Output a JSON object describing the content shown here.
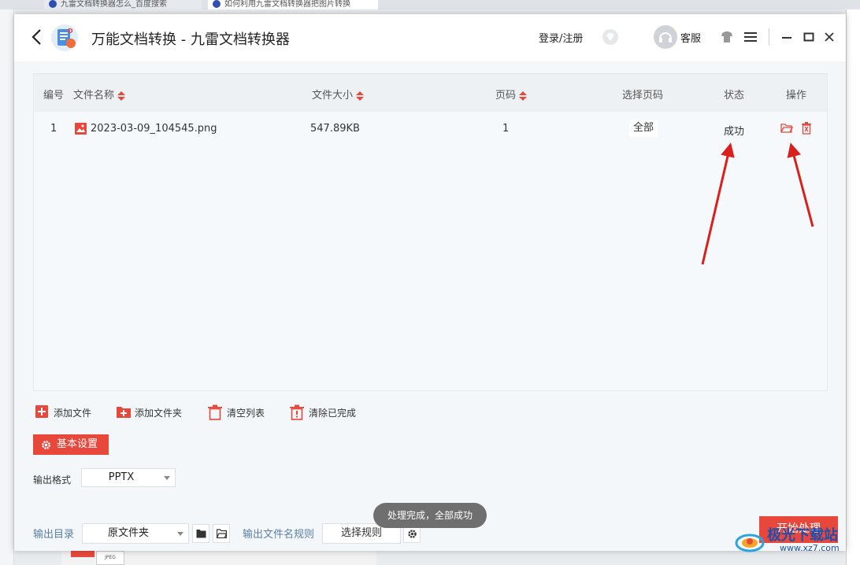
{
  "browser": {
    "tabs": [
      "九雷文档转换器怎么_百度搜索",
      "如何利用九雷文档转换器把图片转换"
    ]
  },
  "app": {
    "title": "万能文档转换 - 九雷文档转换器",
    "login": "登录/注册",
    "service": "客服"
  },
  "table": {
    "headers": {
      "index": "编号",
      "name": "文件名称",
      "size": "文件大小",
      "pages": "页码",
      "select_pages": "选择页码",
      "status": "状态",
      "ops": "操作"
    },
    "rows": [
      {
        "index": "1",
        "name": "2023-03-09_104545.png",
        "size": "547.89KB",
        "pages": "1",
        "select_pages": "全部",
        "status": "成功"
      }
    ]
  },
  "actions": {
    "add_file": "添加文件",
    "add_folder": "添加文件夹",
    "clear_list": "清空列表",
    "clear_done": "清除已完成"
  },
  "settings": {
    "button": "基本设置",
    "output_format_label": "输出格式",
    "output_format": "PPTX",
    "output_dir_label": "输出目录",
    "output_dir": "原文件夹",
    "filename_rule_label": "输出文件名规则",
    "filename_rule_button": "选择规则"
  },
  "toast": "处理完成，全部成功",
  "start_button": "开始处理",
  "watermark": {
    "text": "极光下载站",
    "sub": "www.xz7.com"
  },
  "colors": {
    "accent": "#e8473b",
    "link": "#5a7fa4"
  }
}
